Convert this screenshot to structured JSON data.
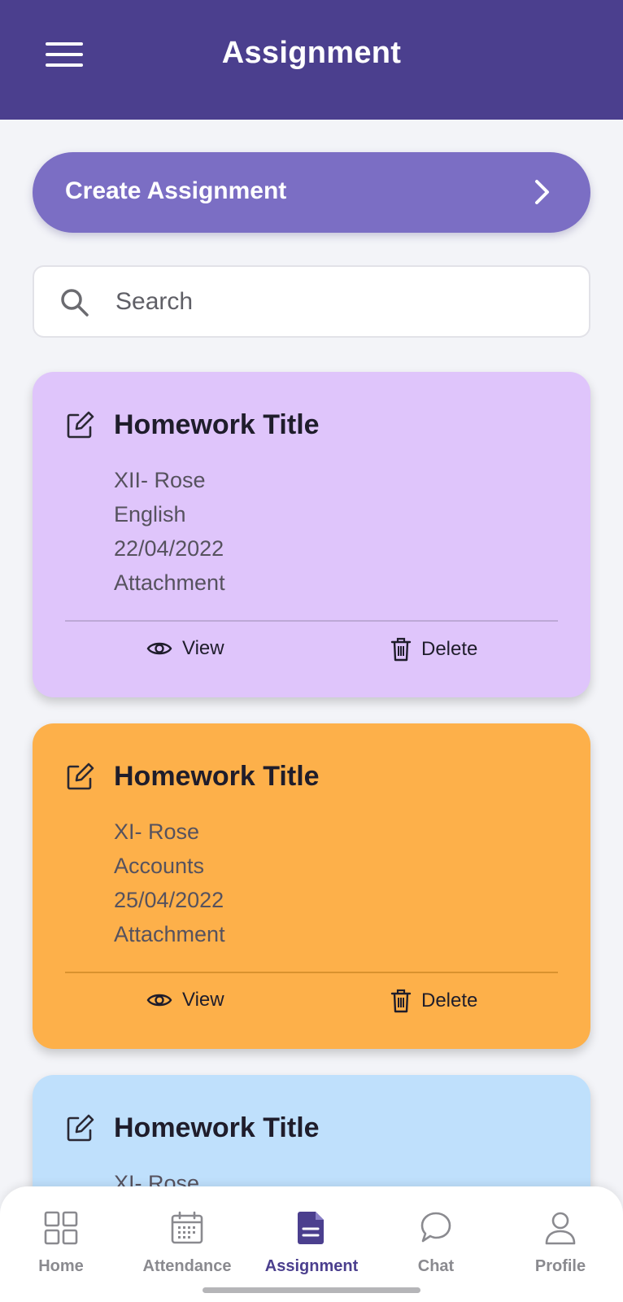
{
  "header": {
    "title": "Assignment"
  },
  "create_button": {
    "label": "Create Assignment"
  },
  "search": {
    "placeholder": "Search"
  },
  "assignments": [
    {
      "title": "Homework Title",
      "class": "XII- Rose",
      "subject": "English",
      "date": "22/04/2022",
      "attachment": "Attachment",
      "view_label": "View",
      "delete_label": "Delete",
      "color": "#dfc5fb",
      "divider_color": "#bda8d6"
    },
    {
      "title": "Homework Title",
      "class": "XI- Rose",
      "subject": "Accounts",
      "date": "25/04/2022",
      "attachment": "Attachment",
      "view_label": "View",
      "delete_label": "Delete",
      "color": "#fdb04a",
      "divider_color": "#d9922f"
    },
    {
      "title": "Homework Title",
      "class": "XI- Rose",
      "color": "#bfe0fc"
    }
  ],
  "bottom_nav": [
    {
      "label": "Home",
      "icon": "grid-icon"
    },
    {
      "label": "Attendance",
      "icon": "calendar-icon"
    },
    {
      "label": "Assignment",
      "icon": "document-icon",
      "active": true
    },
    {
      "label": "Chat",
      "icon": "chat-bubble-icon"
    },
    {
      "label": "Profile",
      "icon": "user-icon"
    }
  ],
  "colors": {
    "primary": "#4b3f8e",
    "create_button": "#7b6ec4",
    "background": "#f3f4f8"
  }
}
